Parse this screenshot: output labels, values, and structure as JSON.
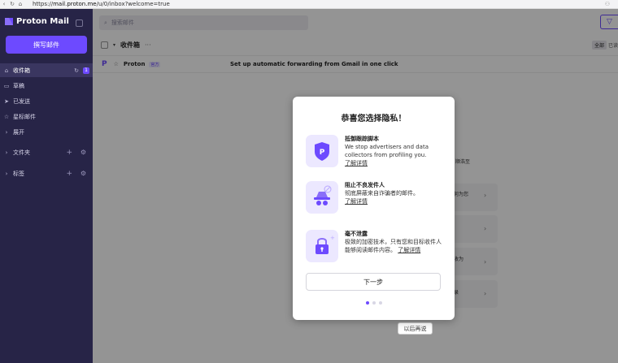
{
  "browser": {
    "url_prefix": "https://",
    "url_host": "mail.proton.me",
    "url_path": "/u/0/inbox?welcome=true"
  },
  "sidebar": {
    "brand": "Proton Mail",
    "compose_label": "撰写邮件",
    "items": [
      {
        "label": "收件箱",
        "icon": "inbox-icon",
        "count": "1"
      },
      {
        "label": "草稿",
        "icon": "draft-icon"
      },
      {
        "label": "已发送",
        "icon": "send-icon"
      },
      {
        "label": "星标邮件",
        "icon": "star-icon"
      },
      {
        "label": "展开",
        "icon": "chevron-right-icon"
      },
      {
        "label": "文件夹",
        "icon": "chevron-right-icon"
      },
      {
        "label": "标签",
        "icon": "chevron-right-icon"
      }
    ]
  },
  "topbar": {
    "search_placeholder": "搜索邮件"
  },
  "toolbar": {
    "folder_title": "收件箱",
    "more": "···",
    "filter_all": "全部",
    "filter_read": "已读"
  },
  "mail": {
    "sender": "Proton",
    "badge": "官方",
    "subject": "Set up automatic forwarding from Gmail in one click"
  },
  "background_cards": {
    "text1": "顺浩至",
    "text2": "何为您",
    "text3": "收为",
    "text4": "录"
  },
  "later_label": "以后再说",
  "modal": {
    "title": "恭喜您选择隐私！",
    "features": [
      {
        "title": "抵御跟踪脚本",
        "desc": "We stop advertisers and data collectors from profiling you.",
        "link": "了解详情",
        "icon": "shield-p-icon"
      },
      {
        "title": "阻止不良发件人",
        "desc": "彻底屏蔽来自诈骗者的邮件。",
        "link": "了解详情",
        "icon": "block-spy-icon"
      },
      {
        "title": "毫不泄露",
        "desc": "极致的加密技术，只有您和目标收件人能够阅读邮件内容。",
        "link": "了解详情",
        "icon": "lock-icon"
      }
    ],
    "next_label": "下一步",
    "step": 1,
    "total_steps": 3
  },
  "colors": {
    "brand": "#6d4aff",
    "sidebar": "#272447"
  }
}
